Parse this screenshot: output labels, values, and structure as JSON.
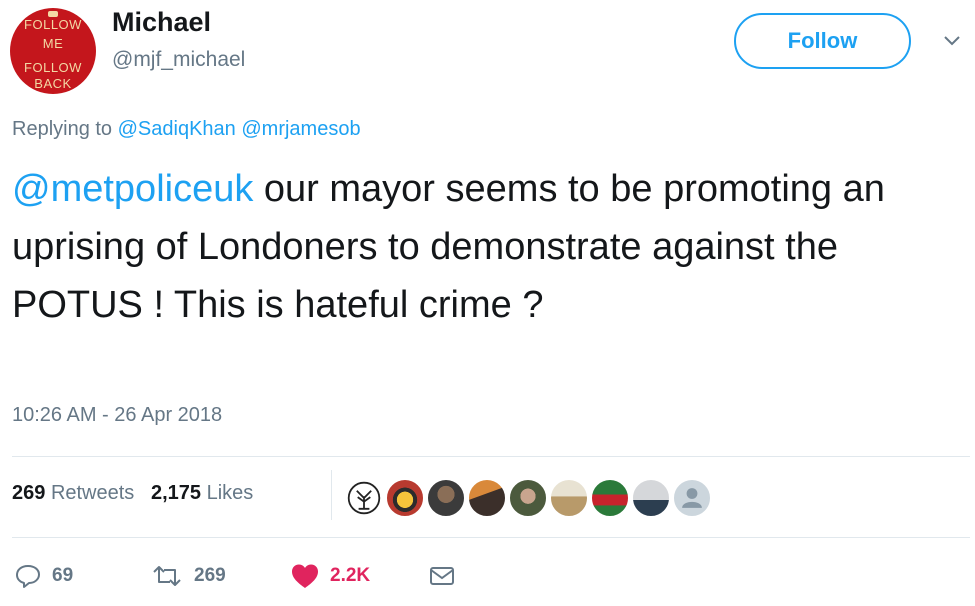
{
  "author": {
    "name": "Michael",
    "handle": "@mjf_michael",
    "avatar_text": [
      "FOLLOW",
      "ME",
      "FOLLOW",
      "BACK"
    ]
  },
  "follow_label": "Follow",
  "reply": {
    "prefix": "Replying to",
    "mentions": [
      "@SadiqKhan",
      "@mrjamesob"
    ]
  },
  "tweet": {
    "mention": "@metpoliceuk",
    "text": "our mayor seems to be promoting an uprising of Londoners to demonstrate against the POTUS ! This is hateful crime ?"
  },
  "timestamp": "10:26 AM - 26 Apr 2018",
  "stats": {
    "retweets_count": "269",
    "retweets_label": "Retweets",
    "likes_count": "2,175",
    "likes_label": "Likes"
  },
  "liker_avatars": [
    "tree-logo",
    "smiley",
    "person",
    "landscape",
    "person",
    "dog",
    "football",
    "silhouette",
    "default"
  ],
  "actions": {
    "replies": "69",
    "retweets": "269",
    "likes": "2.2K"
  },
  "colors": {
    "accent": "#1da1f2",
    "like": "#e0245e",
    "muted": "#657786"
  }
}
